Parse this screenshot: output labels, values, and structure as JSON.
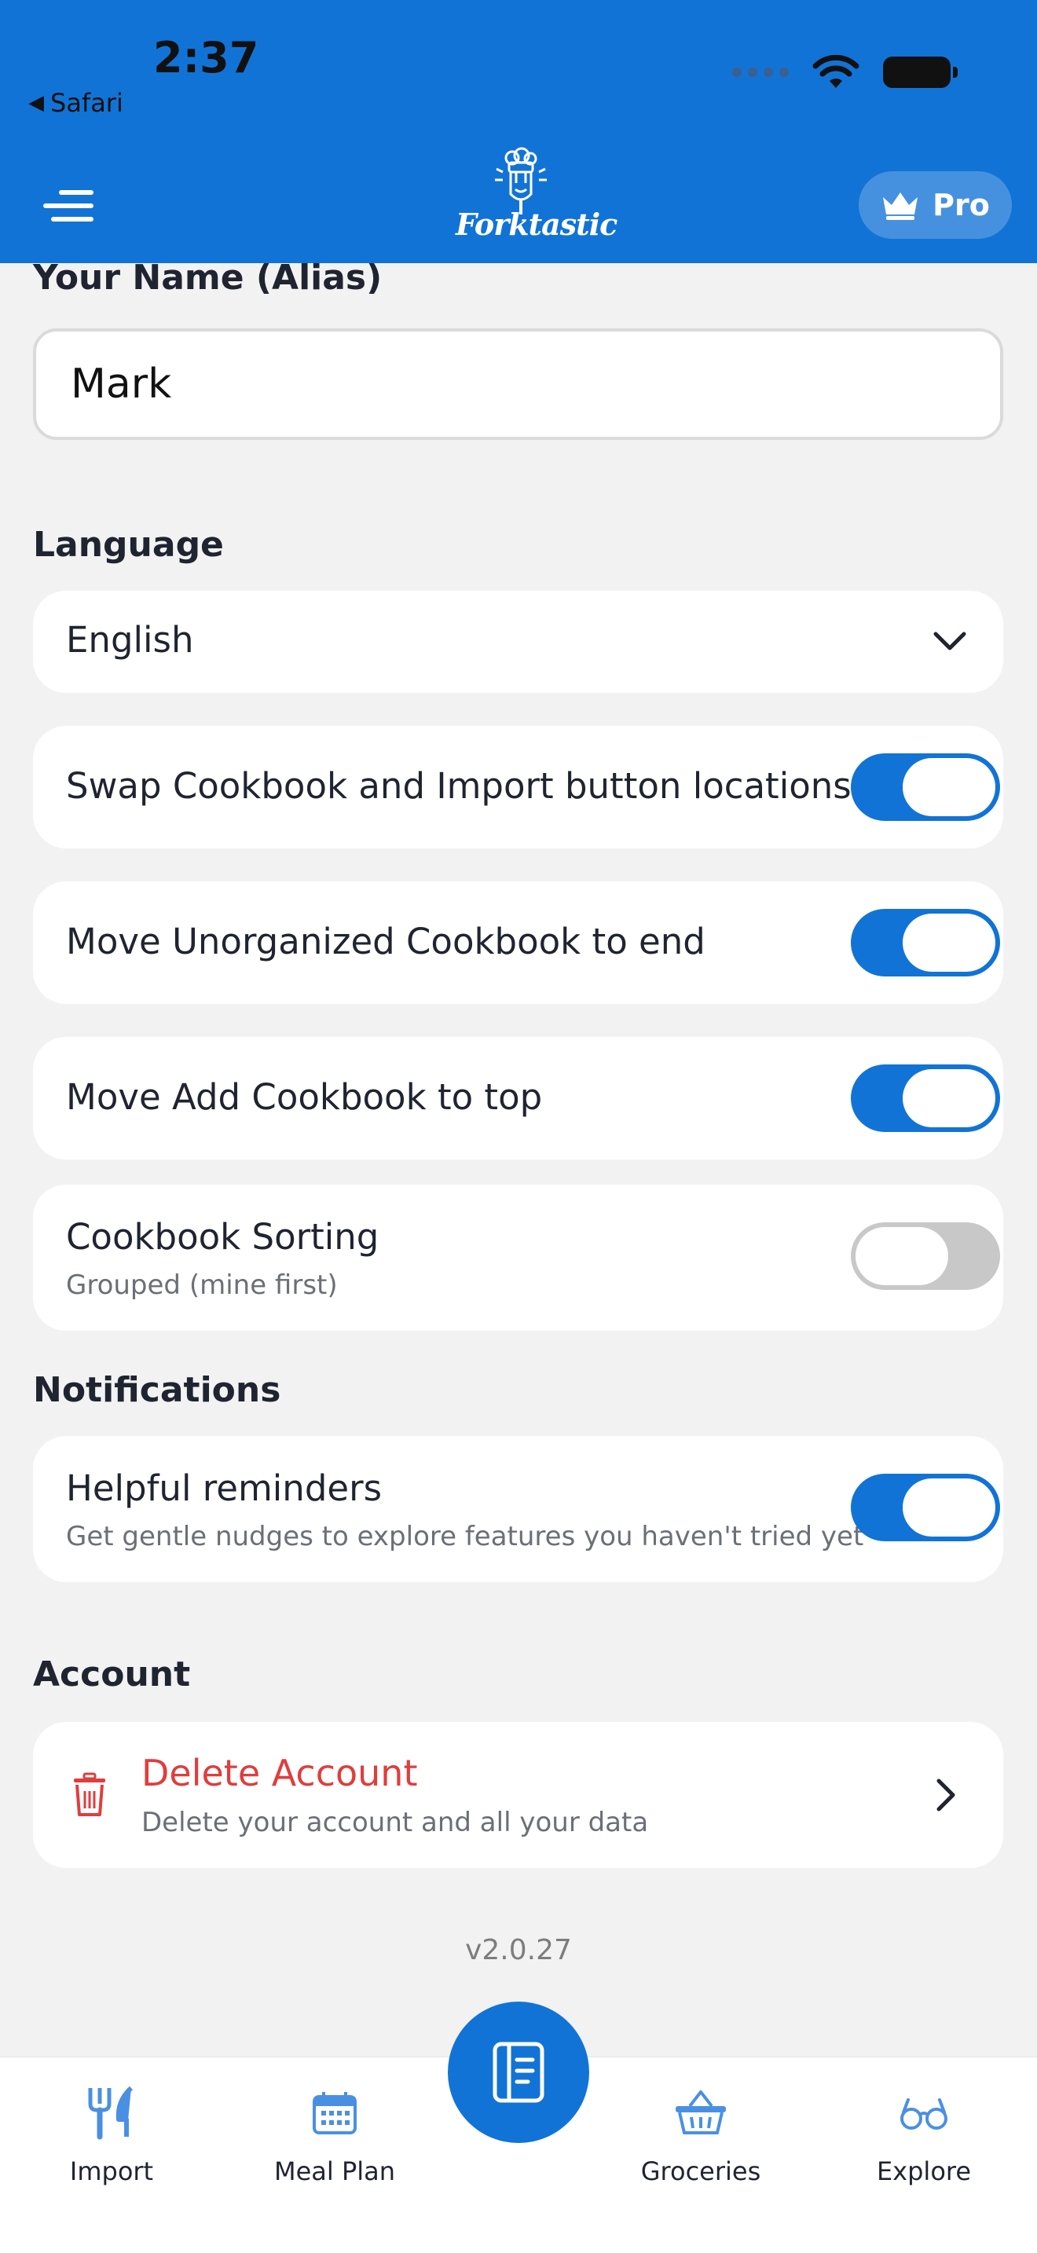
{
  "status_bar": {
    "time": "2:37",
    "back_label": "Safari"
  },
  "header": {
    "logo_text": "Forktastic",
    "pro_label": "Pro"
  },
  "profile": {
    "name_label": "Your Name (Alias)",
    "name_value": "Mark"
  },
  "language": {
    "label": "Language",
    "selected": "English"
  },
  "settings": [
    {
      "title": "Swap Cookbook and Import button locations",
      "enabled": true
    },
    {
      "title": "Move Unorganized Cookbook to end",
      "enabled": true
    },
    {
      "title": "Move Add Cookbook to top",
      "enabled": true
    },
    {
      "title": "Cookbook Sorting",
      "subtitle": "Grouped (mine first)",
      "enabled": false
    }
  ],
  "notifications": {
    "label": "Notifications",
    "title": "Helpful reminders",
    "subtitle": "Get gentle nudges to explore features you haven't tried yet",
    "enabled": true
  },
  "account": {
    "label": "Account",
    "delete_title": "Delete Account",
    "delete_subtitle": "Delete your account and all your data"
  },
  "version": "v2.0.27",
  "bottom_nav": {
    "import": "Import",
    "meal_plan": "Meal Plan",
    "groceries": "Groceries",
    "explore": "Explore"
  },
  "colors": {
    "primary": "#1273d6",
    "danger": "#e03d3d",
    "toggle_off": "#c8c8c8"
  }
}
